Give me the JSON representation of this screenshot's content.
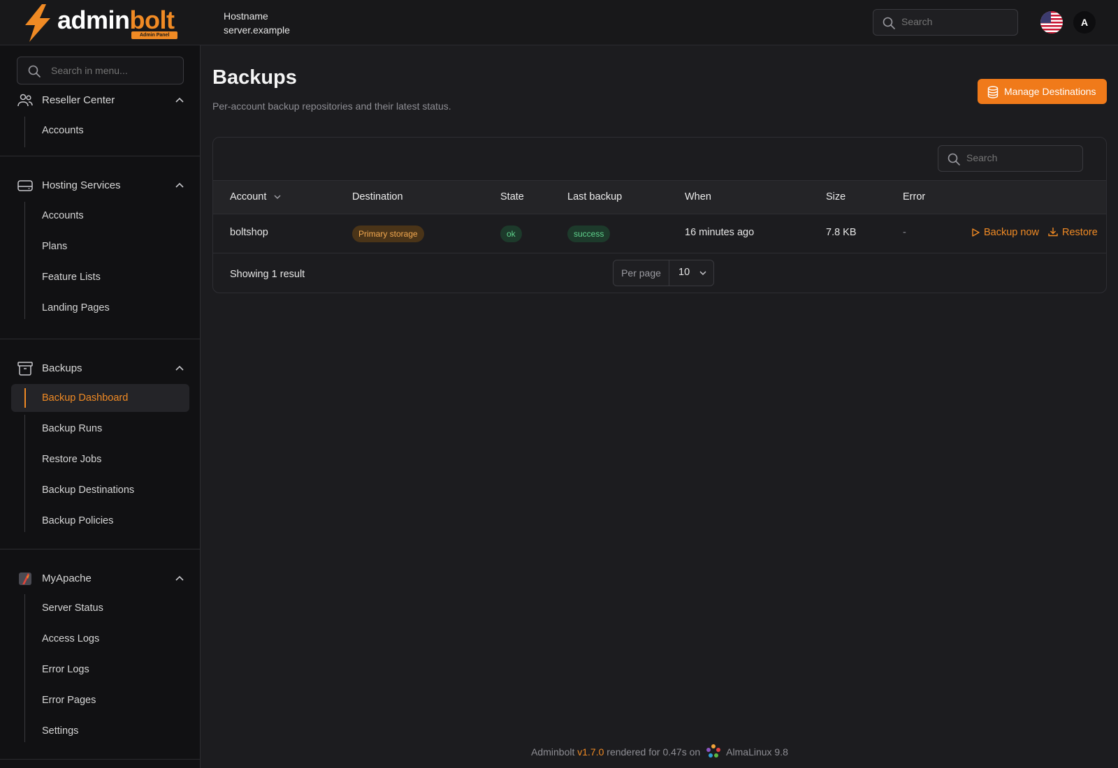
{
  "app": {
    "name_main": "admin",
    "name_accent": "bolt",
    "badge": "Admin Panel"
  },
  "header": {
    "hostname_label": "Hostname",
    "hostname_value": "server.example",
    "search_placeholder": "Search",
    "avatar_initial": "A"
  },
  "sidebar": {
    "search_placeholder": "Search in menu...",
    "groups": [
      {
        "label": "Reseller Center",
        "items": [
          "Accounts"
        ]
      },
      {
        "label": "Hosting Services",
        "items": [
          "Accounts",
          "Plans",
          "Feature Lists",
          "Landing Pages"
        ]
      },
      {
        "label": "Backups",
        "items": [
          "Backup Dashboard",
          "Backup Runs",
          "Restore Jobs",
          "Backup Destinations",
          "Backup Policies"
        ],
        "active": "Backup Dashboard"
      },
      {
        "label": "MyApache",
        "items": [
          "Server Status",
          "Access Logs",
          "Error Logs",
          "Error Pages",
          "Settings"
        ]
      }
    ]
  },
  "page": {
    "title": "Backups",
    "subtitle": "Per-account backup repositories and their latest status.",
    "manage_button": "Manage Destinations"
  },
  "table": {
    "search_placeholder": "Search",
    "columns": [
      "Account",
      "Destination",
      "State",
      "Last backup",
      "When",
      "Size",
      "Error"
    ],
    "rows": [
      {
        "account": "boltshop",
        "destination": "Primary storage",
        "state": "ok",
        "last_backup": "success",
        "when": "16 minutes ago",
        "size": "7.8 KB",
        "error": "-",
        "action_backup": "Backup now",
        "action_restore": "Restore"
      }
    ],
    "footer_text": "Showing 1 result",
    "per_page_label": "Per page",
    "per_page_value": "10"
  },
  "footer": {
    "app": "Adminbolt",
    "version": "v1.7.0",
    "rendered": "rendered for 0.47s on",
    "os": "AlmaLinux 9.8"
  },
  "colors": {
    "accent": "#f08a24",
    "background": "#1c1c1f",
    "sidebar": "#111113",
    "success": "#5fd38d"
  }
}
